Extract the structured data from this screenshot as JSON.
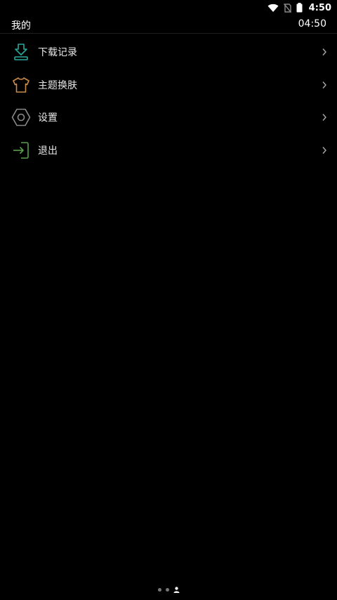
{
  "status_bar": {
    "time": "4:50",
    "icons": [
      "wifi-icon",
      "no-sim-icon",
      "battery-icon"
    ]
  },
  "header": {
    "title": "我的",
    "time": "04:50"
  },
  "menu": {
    "items": [
      {
        "label": "下载记录",
        "icon": "download-icon",
        "icon_color": "#2aa89a"
      },
      {
        "label": "主题换肤",
        "icon": "tshirt-icon",
        "icon_color": "#c98a4b"
      },
      {
        "label": "设置",
        "icon": "settings-hexagon-icon",
        "icon_color": "#8a8a8a"
      },
      {
        "label": "退出",
        "icon": "logout-icon",
        "icon_color": "#5aa04a"
      }
    ]
  },
  "page_indicator": {
    "dots": 3,
    "active": "user-icon"
  }
}
